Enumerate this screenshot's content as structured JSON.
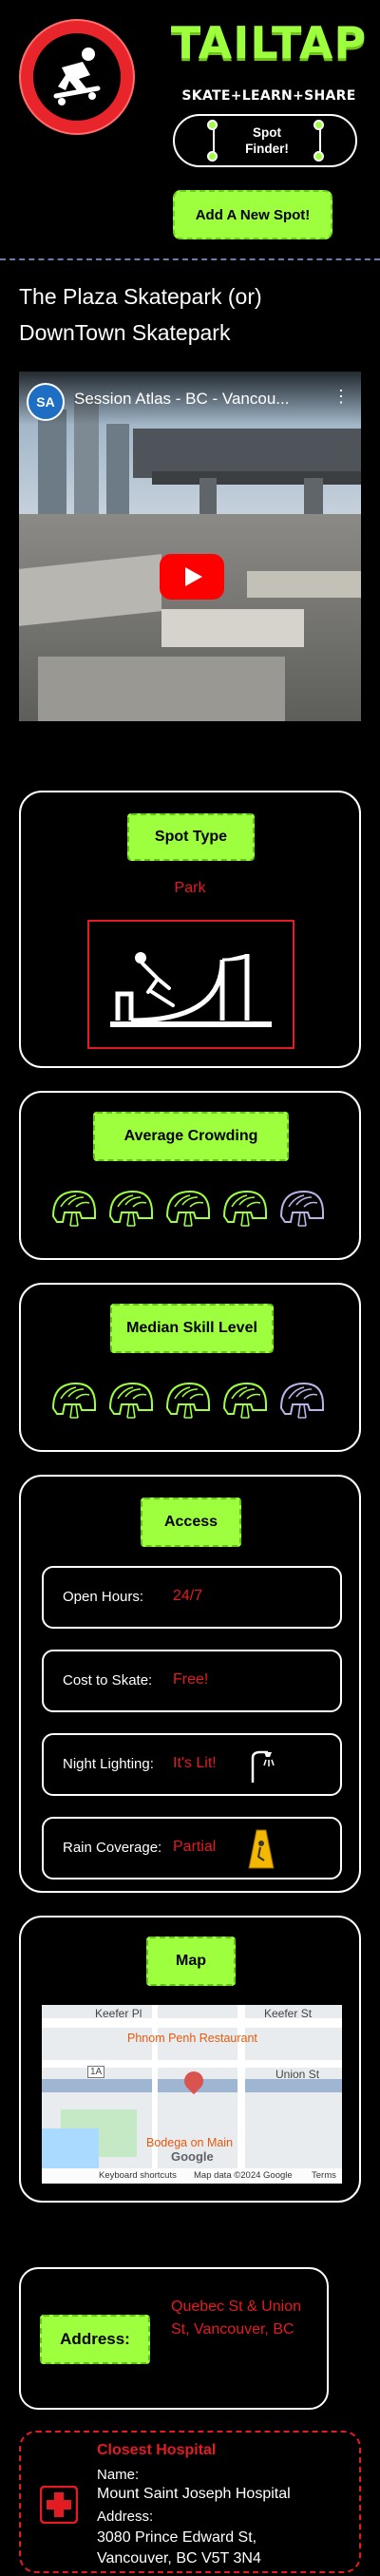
{
  "header": {
    "brand": "TAILTAP",
    "tagline": "SKATE+LEARN+SHARE",
    "spot_finder_label": "Spot Finder!",
    "add_spot_label": "Add A New Spot!"
  },
  "spot": {
    "title": "The Plaza Skatepark (or) DownTown Skatepark"
  },
  "video": {
    "channel_initials": "SA",
    "title": "Session Atlas - BC - Vancou...",
    "menu_glyph": "⋮"
  },
  "spot_type": {
    "heading": "Spot Type",
    "value": "Park",
    "icon": "halfpipe-skater-icon"
  },
  "crowding": {
    "heading": "Average Crowding",
    "rating": 4,
    "max": 5
  },
  "skill": {
    "heading": "Median Skill Level",
    "rating": 4,
    "max": 5
  },
  "access": {
    "heading": "Access",
    "open_hours_label": "Open Hours:",
    "open_hours_value": "24/7",
    "cost_label": "Cost to Skate:",
    "cost_value": "Free!",
    "lighting_label": "Night Lighting:",
    "lighting_value": "It's Lit!",
    "rain_label": "Rain Coverage:",
    "rain_value": "Partial"
  },
  "map": {
    "heading": "Map",
    "streets": [
      "Keefer Pl",
      "Keefer St",
      "Union St"
    ],
    "pois": [
      "Phnom Penh Restaurant",
      "Bodega on Main"
    ],
    "highway_label": "1A",
    "provider": "Google",
    "footer": [
      "Keyboard shortcuts",
      "Map data ©2024 Google",
      "Terms"
    ]
  },
  "address": {
    "label": "Address:",
    "value": "Quebec St & Union St, Vancouver, BC"
  },
  "hospital": {
    "heading": "Closest Hospital",
    "name_label": "Name:",
    "name": "Mount Saint Joseph Hospital",
    "address_label": "Address:",
    "address": "3080 Prince Edward St, Vancouver, BC V5T 3N4"
  },
  "colors": {
    "accent_green": "#9dff3d",
    "alert_red": "#e31b23",
    "background": "#000000"
  }
}
